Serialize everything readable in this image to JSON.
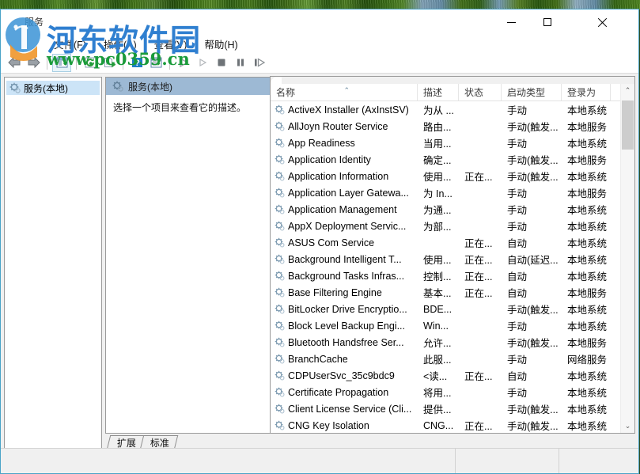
{
  "window": {
    "title": "服务",
    "minimize_label": "最小化",
    "maximize_label": "最大化",
    "close_label": "关闭"
  },
  "menubar": {
    "items": [
      {
        "label": "文件(F)"
      },
      {
        "label": "操作(A)"
      },
      {
        "label": "查看(V)"
      },
      {
        "label": "帮助(H)"
      }
    ]
  },
  "toolbar": {
    "buttons": [
      {
        "name": "back-button",
        "icon": "arrow-left-icon"
      },
      {
        "name": "forward-button",
        "icon": "arrow-right-icon"
      },
      {
        "name": "show-hide-tree-button",
        "icon": "tree-pane-icon"
      },
      {
        "name": "refresh-button",
        "icon": "refresh-icon"
      },
      {
        "name": "export-list-button",
        "icon": "export-icon"
      },
      {
        "name": "help-button",
        "icon": "question-mark-icon"
      },
      {
        "name": "show-action-pane-button",
        "icon": "action-pane-icon"
      },
      {
        "name": "start-service-button",
        "icon": "play-icon"
      },
      {
        "name": "resume-service-button",
        "icon": "play-small-icon"
      },
      {
        "name": "stop-service-button",
        "icon": "stop-icon"
      },
      {
        "name": "pause-service-button",
        "icon": "pause-icon"
      },
      {
        "name": "restart-service-button",
        "icon": "restart-icon"
      }
    ]
  },
  "tree": {
    "root_label": "服务(本地)"
  },
  "details": {
    "header": "服务(本地)",
    "hint": "选择一个项目来查看它的描述。"
  },
  "list": {
    "columns": [
      {
        "key": "name",
        "label": "名称",
        "sorted": true,
        "sort_glyph": "⌃"
      },
      {
        "key": "desc",
        "label": "描述"
      },
      {
        "key": "status",
        "label": "状态"
      },
      {
        "key": "startup",
        "label": "启动类型"
      },
      {
        "key": "logon",
        "label": "登录为"
      }
    ],
    "rows": [
      {
        "name": "ActiveX Installer (AxInstSV)",
        "desc": "为从 ...",
        "status": "",
        "startup": "手动",
        "logon": "本地系统"
      },
      {
        "name": "AllJoyn Router Service",
        "desc": "路由...",
        "status": "",
        "startup": "手动(触发...",
        "logon": "本地服务"
      },
      {
        "name": "App Readiness",
        "desc": "当用...",
        "status": "",
        "startup": "手动",
        "logon": "本地系统"
      },
      {
        "name": "Application Identity",
        "desc": "确定...",
        "status": "",
        "startup": "手动(触发...",
        "logon": "本地服务"
      },
      {
        "name": "Application Information",
        "desc": "使用...",
        "status": "正在...",
        "startup": "手动(触发...",
        "logon": "本地系统"
      },
      {
        "name": "Application Layer Gatewa...",
        "desc": "为 In...",
        "status": "",
        "startup": "手动",
        "logon": "本地服务"
      },
      {
        "name": "Application Management",
        "desc": "为通...",
        "status": "",
        "startup": "手动",
        "logon": "本地系统"
      },
      {
        "name": "AppX Deployment Servic...",
        "desc": "为部...",
        "status": "",
        "startup": "手动",
        "logon": "本地系统"
      },
      {
        "name": "ASUS Com Service",
        "desc": "",
        "status": "正在...",
        "startup": "自动",
        "logon": "本地系统"
      },
      {
        "name": "Background Intelligent T...",
        "desc": "使用...",
        "status": "正在...",
        "startup": "自动(延迟...",
        "logon": "本地系统"
      },
      {
        "name": "Background Tasks Infras...",
        "desc": "控制...",
        "status": "正在...",
        "startup": "自动",
        "logon": "本地系统"
      },
      {
        "name": "Base Filtering Engine",
        "desc": "基本...",
        "status": "正在...",
        "startup": "自动",
        "logon": "本地服务"
      },
      {
        "name": "BitLocker Drive Encryptio...",
        "desc": "BDE...",
        "status": "",
        "startup": "手动(触发...",
        "logon": "本地系统"
      },
      {
        "name": "Block Level Backup Engi...",
        "desc": "Win...",
        "status": "",
        "startup": "手动",
        "logon": "本地系统"
      },
      {
        "name": "Bluetooth Handsfree Ser...",
        "desc": "允许...",
        "status": "",
        "startup": "手动(触发...",
        "logon": "本地服务"
      },
      {
        "name": "BranchCache",
        "desc": "此服...",
        "status": "",
        "startup": "手动",
        "logon": "网络服务"
      },
      {
        "name": "CDPUserSvc_35c9bdc9",
        "desc": "<读...",
        "status": "正在...",
        "startup": "自动",
        "logon": "本地系统"
      },
      {
        "name": "Certificate Propagation",
        "desc": "将用...",
        "status": "",
        "startup": "手动",
        "logon": "本地系统"
      },
      {
        "name": "Client License Service (Cli...",
        "desc": "提供...",
        "status": "",
        "startup": "手动(触发...",
        "logon": "本地系统"
      },
      {
        "name": "CNG Key Isolation",
        "desc": "CNG...",
        "status": "正在...",
        "startup": "手动(触发...",
        "logon": "本地系统"
      }
    ],
    "scrollbar": {
      "up_glyph": "⌃",
      "down_glyph": "⌄"
    }
  },
  "tabs": [
    {
      "label": "扩展",
      "active": false
    },
    {
      "label": "标准",
      "active": true
    }
  ],
  "watermark": {
    "site_name": "河东软件园",
    "url": "www.pc0359.cn"
  },
  "colors": {
    "window_border": "#4aa3c7",
    "tree_selection": "#cce4f7",
    "details_header": "#9db9d4",
    "watermark_blue": "#2f7fd0",
    "watermark_green": "#1a9b3a"
  }
}
